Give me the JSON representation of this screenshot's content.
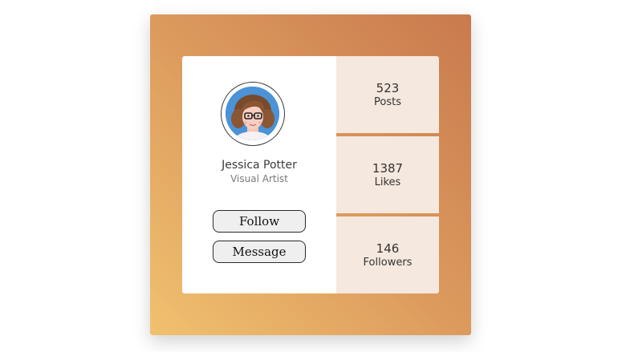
{
  "profile": {
    "name": "Jessica Potter",
    "role": "Visual Artist",
    "follow_label": "Follow",
    "message_label": "Message",
    "avatar_icon": "cartoon-woman-avatar"
  },
  "stats": [
    {
      "value": "523",
      "label": "Posts"
    },
    {
      "value": "1387",
      "label": "Likes"
    },
    {
      "value": "146",
      "label": "Followers"
    }
  ],
  "colors": {
    "gradient_start": "#f0c16f",
    "gradient_end": "#c97a4e",
    "stat_panel": "#f5e8de",
    "button_bg": "#efefef"
  }
}
